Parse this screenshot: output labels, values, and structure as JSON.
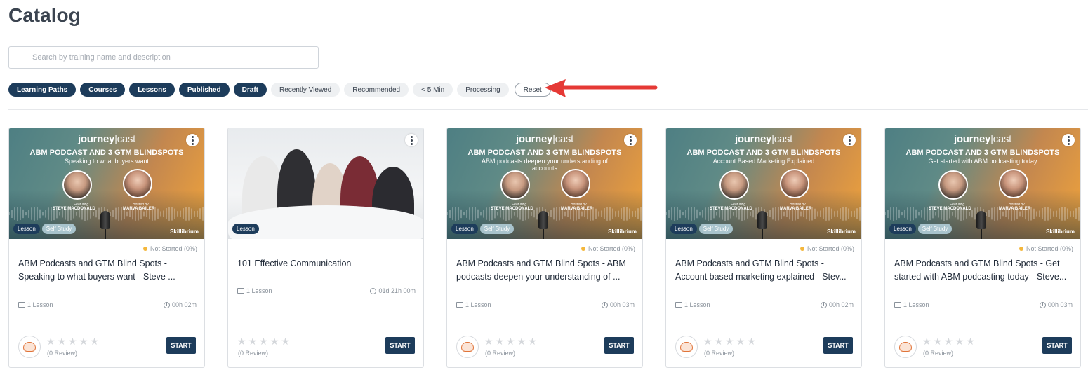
{
  "page": {
    "title": "Catalog"
  },
  "search": {
    "placeholder": "Search by training name and description"
  },
  "filters": [
    {
      "label": "Learning Paths",
      "active": true
    },
    {
      "label": "Courses",
      "active": true
    },
    {
      "label": "Lessons",
      "active": true
    },
    {
      "label": "Published",
      "active": true
    },
    {
      "label": "Draft",
      "active": true
    },
    {
      "label": "Recently Viewed",
      "active": false
    },
    {
      "label": "Recommended",
      "active": false
    },
    {
      "label": "< 5 Min",
      "active": false
    },
    {
      "label": "Processing",
      "active": false
    }
  ],
  "reset_label": "Reset",
  "arrow_color": "#e53935",
  "colors": {
    "primary": "#1d3c5b",
    "status_dot": "#f4b73c"
  },
  "podcast_thumb": {
    "brand_left": "journey",
    "brand_right": "cast",
    "title": "ABM PODCAST AND 3 GTM BLINDSPOTS",
    "featuring_label": "Featuring",
    "featuring_name": "STEVE MACDONALD",
    "hosted_label": "Hosted by",
    "hosted_name": "MARVA BAILER",
    "logo": "Skillibrium"
  },
  "cards": [
    {
      "thumb_kind": "podcast",
      "thumb_subtitle": "Speaking to what buyers want",
      "type_badge": "Lesson",
      "study_badge": "Self Study",
      "status": "Not Started (0%)",
      "title": "ABM Podcasts and GTM Blind Spots - Speaking to what buyers want - Steve ...",
      "lessons": "1 Lesson",
      "duration": "00h 02m",
      "reviews": "(0 Review)",
      "start_label": "START"
    },
    {
      "thumb_kind": "photo",
      "thumb_subtitle": "",
      "type_badge": "Lesson",
      "study_badge": "",
      "status": "",
      "title": "101 Effective Communication",
      "lessons": "1 Lesson",
      "duration": "01d 21h 00m",
      "reviews": "(0 Review)",
      "start_label": "START"
    },
    {
      "thumb_kind": "podcast",
      "thumb_subtitle": "ABM podcasts deepen your understanding of accounts",
      "type_badge": "Lesson",
      "study_badge": "Self Study",
      "status": "Not Started (0%)",
      "title": "ABM Podcasts and GTM Blind Spots - ABM podcasts deepen your understanding of ...",
      "lessons": "1 Lesson",
      "duration": "00h 03m",
      "reviews": "(0 Review)",
      "start_label": "START"
    },
    {
      "thumb_kind": "podcast",
      "thumb_subtitle": "Account Based Marketing Explained",
      "type_badge": "Lesson",
      "study_badge": "Self Study",
      "status": "Not Started (0%)",
      "title": "ABM Podcasts and GTM Blind Spots - Account based marketing explained - Stev...",
      "lessons": "1 Lesson",
      "duration": "00h 02m",
      "reviews": "(0 Review)",
      "start_label": "START"
    },
    {
      "thumb_kind": "podcast",
      "thumb_subtitle": "Get started with ABM podcasting today",
      "type_badge": "Lesson",
      "study_badge": "Self Study",
      "status": "Not Started (0%)",
      "title": "ABM Podcasts and GTM Blind Spots - Get started with ABM podcasting today - Steve...",
      "lessons": "1 Lesson",
      "duration": "00h 03m",
      "reviews": "(0 Review)",
      "start_label": "START"
    }
  ]
}
